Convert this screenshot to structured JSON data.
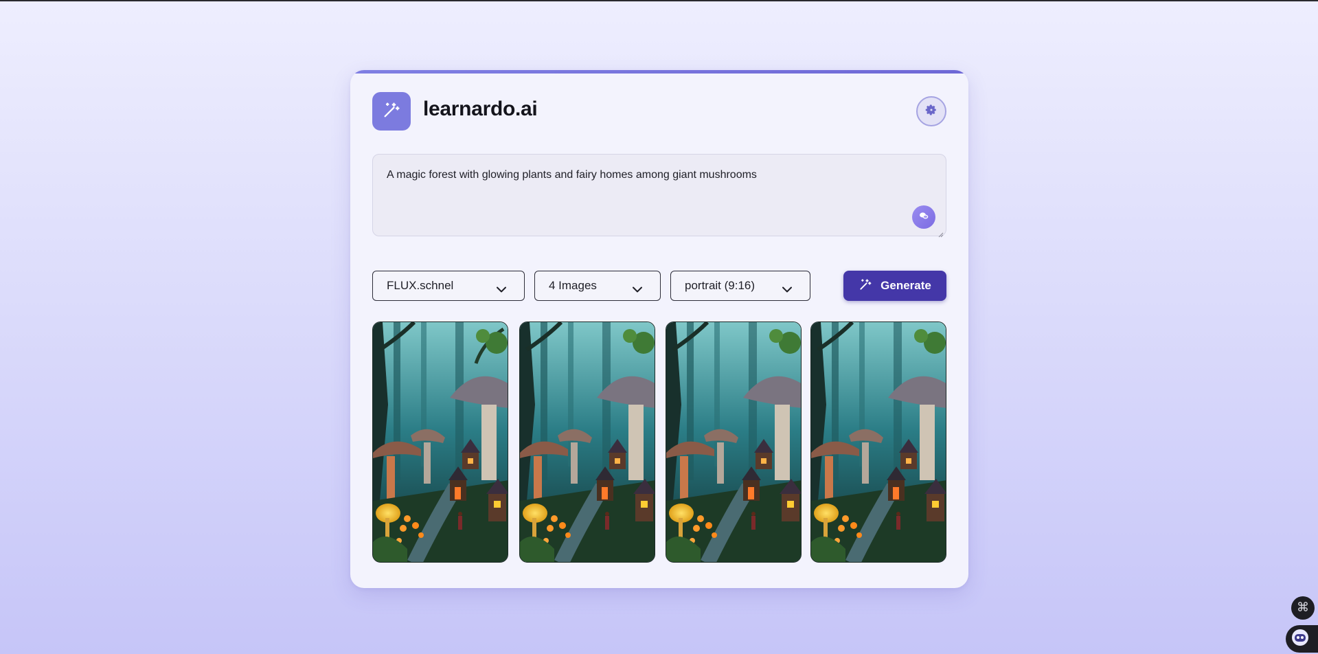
{
  "app": {
    "brand": "learnardo.ai"
  },
  "prompt": {
    "value": "A magic forest with glowing plants and fairy homes among giant mushrooms"
  },
  "controls": {
    "model": "FLUX.schnel",
    "count": "4 Images",
    "aspect": "portrait (9:16)",
    "generate_label": "Generate"
  },
  "colors": {
    "accent": "#7c7bdf",
    "generate": "#4437a8",
    "background_top": "#eeeefe",
    "background_bottom": "#c6c5f8"
  },
  "icons": {
    "logo": "magic-wand-icon",
    "settings": "gear-icon",
    "prompt_enhance": "sparkle-chat-icon",
    "generate": "magic-wand-icon",
    "dropdown": "chevron-down-icon",
    "shortcuts": "command-icon",
    "assistant": "bot-icon"
  },
  "results": [
    {
      "id": "image-1"
    },
    {
      "id": "image-2"
    },
    {
      "id": "image-3"
    },
    {
      "id": "image-4"
    }
  ]
}
